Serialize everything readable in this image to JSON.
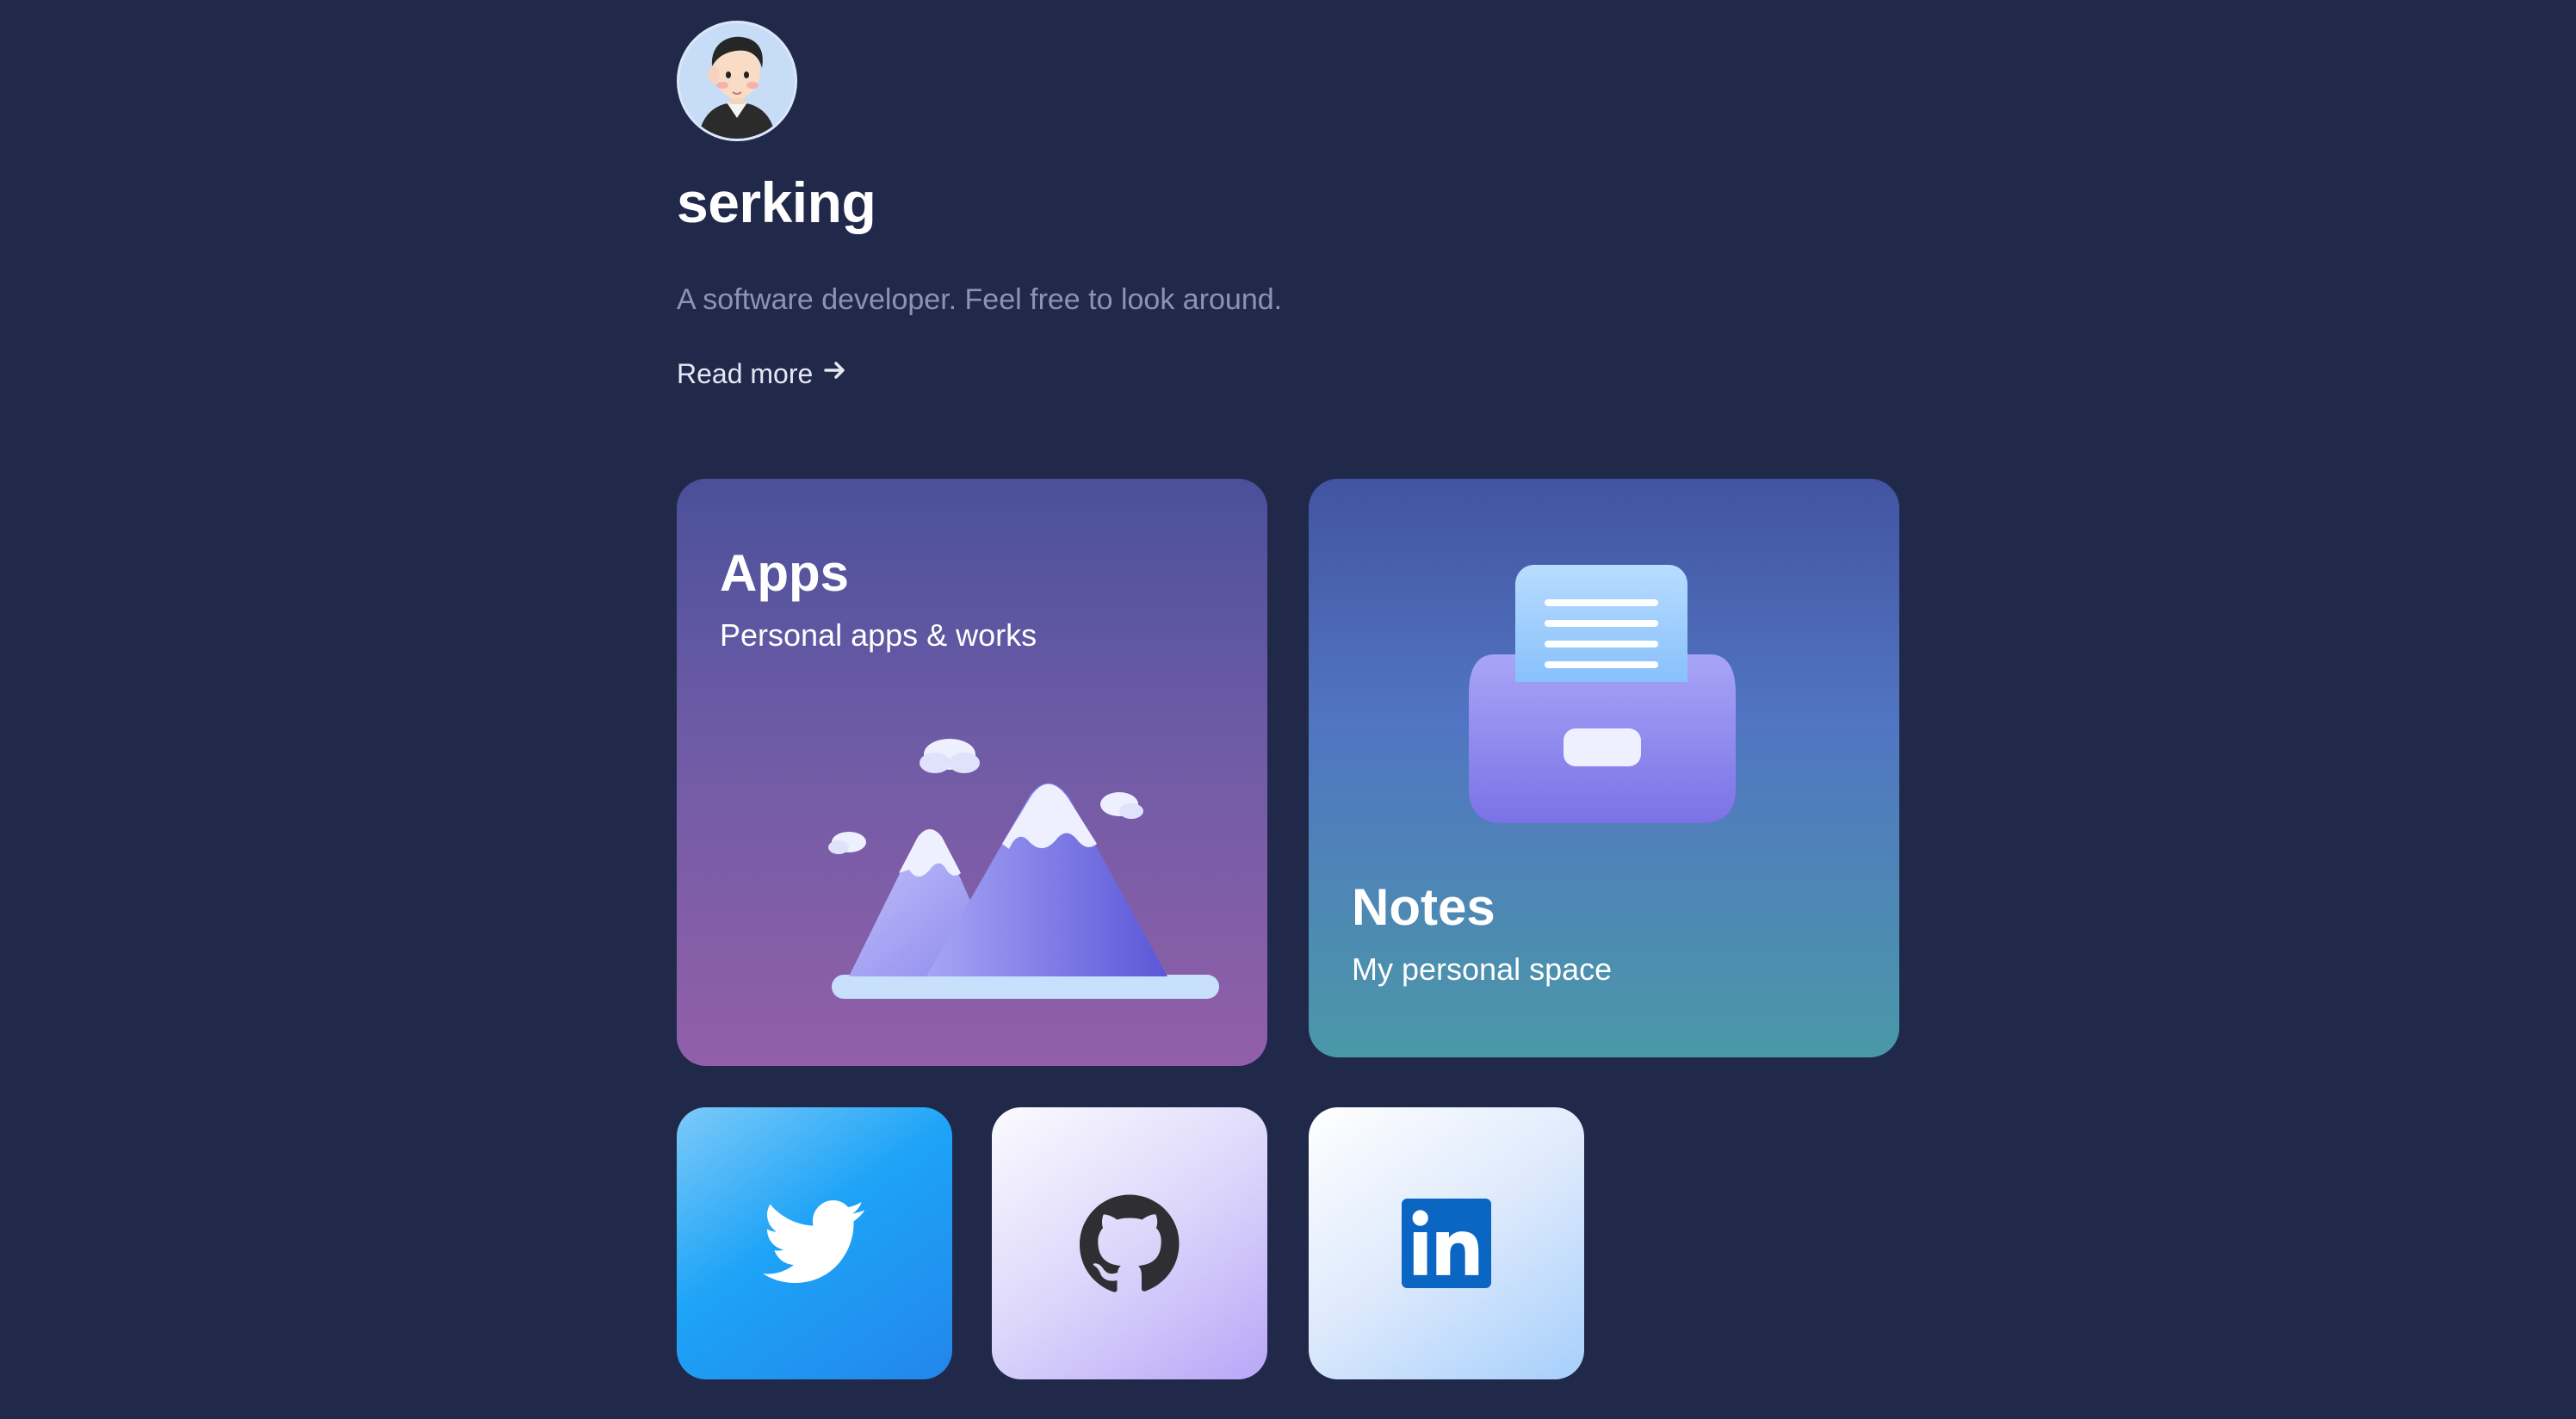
{
  "profile": {
    "name": "serking",
    "tagline": "A software developer. Feel free to look around.",
    "read_more_label": "Read more",
    "avatar_icon": "cartoon-avatar"
  },
  "cards": {
    "apps": {
      "title": "Apps",
      "description": "Personal apps & works",
      "illustration": "snowy-mountains-illustration"
    },
    "notes": {
      "title": "Notes",
      "description": "My personal space",
      "illustration": "file-drawer-illustration"
    }
  },
  "social": {
    "twitter": {
      "icon": "twitter-bird-icon",
      "color": "#1da1f2"
    },
    "github": {
      "icon": "github-octocat-icon",
      "color": "#24292f"
    },
    "linkedin": {
      "icon": "linkedin-logo-icon",
      "color": "#0a66c2"
    }
  },
  "colors": {
    "background": "#21294b",
    "text_primary": "#ffffff",
    "text_muted": "#8c93b6"
  }
}
